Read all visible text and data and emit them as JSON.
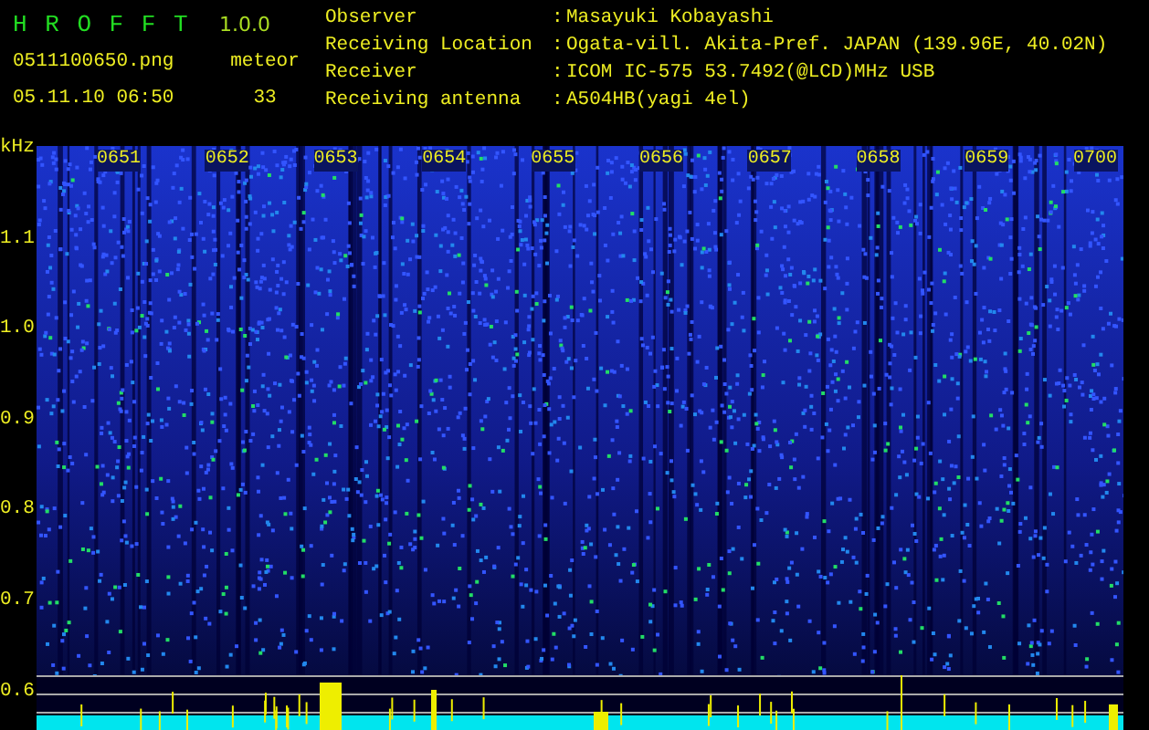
{
  "app": {
    "title": "H R O F F T",
    "version": "1.0.0",
    "file": "0511100650.png",
    "timestamp": "05.11.10 06:50",
    "counter_label": "meteor",
    "counter_value": "33"
  },
  "info": [
    {
      "label": "Observer",
      "separator": ":",
      "value": "Masayuki Kobayashi"
    },
    {
      "label": "Receiving Location",
      "separator": ":",
      "value": "Ogata-vill. Akita-Pref. JAPAN (139.96E, 40.02N)"
    },
    {
      "label": "Receiver",
      "separator": ":",
      "value": "ICOM IC-575 53.7492(@LCD)MHz USB"
    },
    {
      "label": "Receiving antenna",
      "separator": ":",
      "value": "A504HB(yagi 4el)"
    }
  ],
  "spectrogram": {
    "unit": "kHz",
    "y_labels": [
      "1.1",
      "1.0",
      "0.9",
      "0.8",
      "0.7",
      "0.6"
    ],
    "time_labels": [
      "0651",
      "0652",
      "0653",
      "0654",
      "0655",
      "0656",
      "0657",
      "0658",
      "0659",
      "0700"
    ]
  }
}
